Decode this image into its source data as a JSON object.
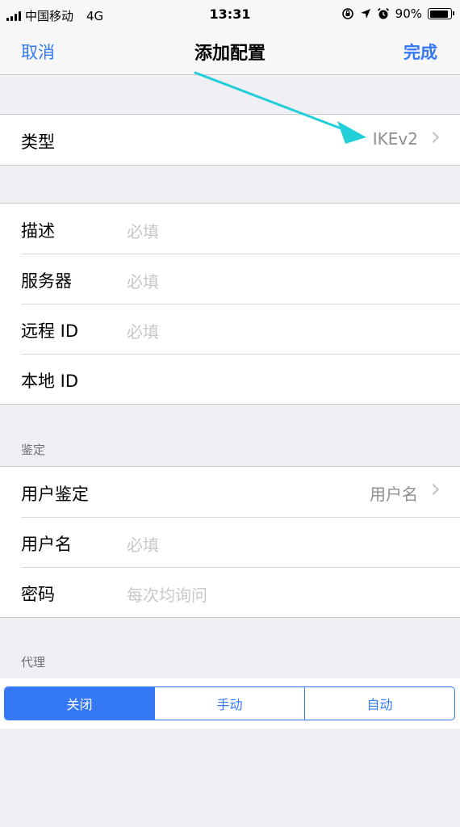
{
  "status_bar": {
    "carrier": "中国移动",
    "network": "4G",
    "time": "13:31",
    "battery": "90%",
    "battery_level": 0.9
  },
  "nav": {
    "cancel": "取消",
    "title": "添加配置",
    "done": "完成"
  },
  "type_row": {
    "label": "类型",
    "value": "IKEv2"
  },
  "server_group": {
    "rows": [
      {
        "label": "描述",
        "placeholder": "必填"
      },
      {
        "label": "服务器",
        "placeholder": "必填"
      },
      {
        "label": "远程 ID",
        "placeholder": "必填"
      },
      {
        "label": "本地 ID",
        "placeholder": ""
      }
    ]
  },
  "auth_section": {
    "header": "鉴定",
    "auth_row": {
      "label": "用户鉴定",
      "value": "用户名"
    },
    "username": {
      "label": "用户名",
      "placeholder": "必填"
    },
    "password": {
      "label": "密码",
      "placeholder": "每次均询问"
    }
  },
  "proxy_section": {
    "header": "代理",
    "segments": [
      "关闭",
      "手动",
      "自动"
    ],
    "selected": "关闭"
  },
  "colors": {
    "accent": "#3478f6",
    "annotation_arrow": "#22cfd9"
  }
}
